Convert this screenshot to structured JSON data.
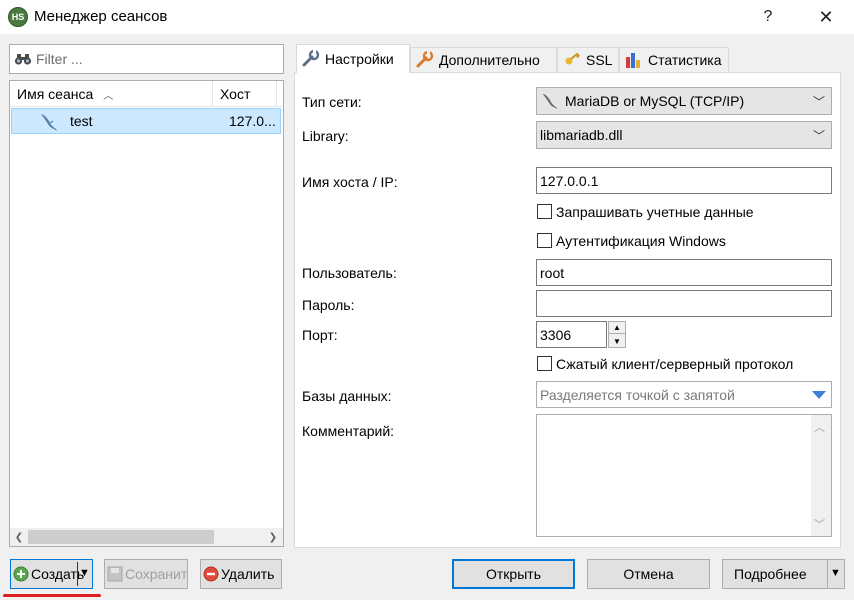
{
  "window": {
    "title": "Менеджер сеансов",
    "app_icon": "HS",
    "help": "?",
    "close": "✕"
  },
  "left": {
    "filter_placeholder": "Filter ...",
    "columns": {
      "name": "Имя сеанса",
      "host": "Хост"
    },
    "sessions": [
      {
        "name": "test",
        "host": "127.0..."
      }
    ]
  },
  "tabs": [
    {
      "label": "Настройки",
      "icon": "wrench-icon"
    },
    {
      "label": "Дополнительно",
      "icon": "wrench-orange-icon"
    },
    {
      "label": "SSL",
      "icon": "key-icon"
    },
    {
      "label": "Статистика",
      "icon": "bar-chart-icon"
    }
  ],
  "settings": {
    "network_type_label": "Тип сети:",
    "network_type_value": "MariaDB or MySQL (TCP/IP)",
    "library_label": "Library:",
    "library_value": "libmariadb.dll",
    "host_label": "Имя хоста / IP:",
    "host_value": "127.0.0.1",
    "prompt_credentials": "Запрашивать учетные данные",
    "windows_auth": "Аутентификация Windows",
    "user_label": "Пользователь:",
    "user_value": "root",
    "password_label": "Пароль:",
    "password_value": "",
    "port_label": "Порт:",
    "port_value": "3306",
    "compressed": "Сжатый клиент/серверный протокол",
    "databases_label": "Базы данных:",
    "databases_placeholder": "Разделяется точкой с запятой",
    "comment_label": "Комментарий:"
  },
  "buttons": {
    "create": "Создать",
    "save": "Сохранить",
    "delete": "Удалить",
    "open": "Открыть",
    "cancel": "Отмена",
    "more": "Подробнее"
  },
  "colors": {
    "accent": "#0078d7",
    "selection": "#cce8ff",
    "underline": "#e02020"
  }
}
